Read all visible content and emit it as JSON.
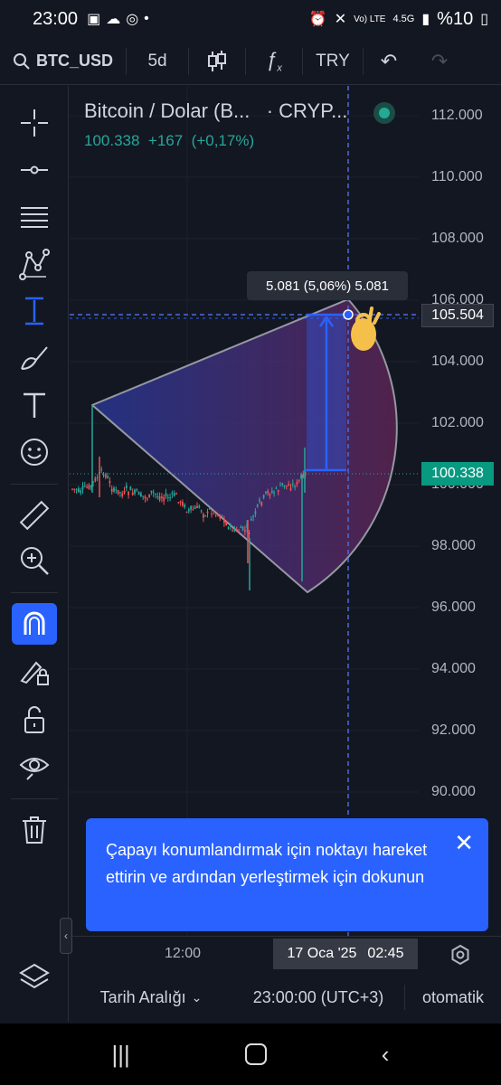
{
  "statusbar": {
    "time": "23:00",
    "battery": "%10",
    "network": "4.5G",
    "volte": "Vo) LTE"
  },
  "toolbar": {
    "symbol": "BTC_USD",
    "interval": "5d",
    "currency": "TRY"
  },
  "legend": {
    "name": "Bitcoin / Dolar (B...",
    "exchange": "· CRYP...",
    "price": "100.338",
    "change": "+167",
    "change_pct": "(+0,17%)"
  },
  "price_axis": {
    "ticks": [
      "112.000",
      "110.000",
      "108.000",
      "106.000",
      "104.000",
      "102.000",
      "100.000",
      "98.000",
      "96.000",
      "94.000",
      "92.000",
      "90.000"
    ],
    "crosshair_price": "105.504",
    "last_price": "100.338"
  },
  "measure": {
    "text": "5.081 (5,06%) 5.081"
  },
  "hint": {
    "text": "Çapayı konumlandırmak için noktayı hareket ettirin ve ardından yerleştirmek için dokunun"
  },
  "time_axis": {
    "label": "12:00",
    "crosshair_date": "17 Oca '25",
    "crosshair_time": "02:45"
  },
  "bottombar": {
    "range": "Tarih Aralığı",
    "time": "23:00:00 (UTC+3)",
    "mode": "otomatik"
  },
  "colors": {
    "background": "#131722",
    "accent": "#2962ff",
    "up": "#26a69a",
    "down": "#ef5350"
  },
  "icons": [
    "crosshair-icon",
    "trend-line-icon",
    "fib-icon",
    "pattern-icon",
    "measure-icon",
    "brush-icon",
    "text-icon",
    "emoji-icon",
    "ruler-icon",
    "zoom-icon",
    "magnet-icon",
    "lock-drawing-icon",
    "lock-icon",
    "eye-icon",
    "trash-icon",
    "layers-icon"
  ]
}
